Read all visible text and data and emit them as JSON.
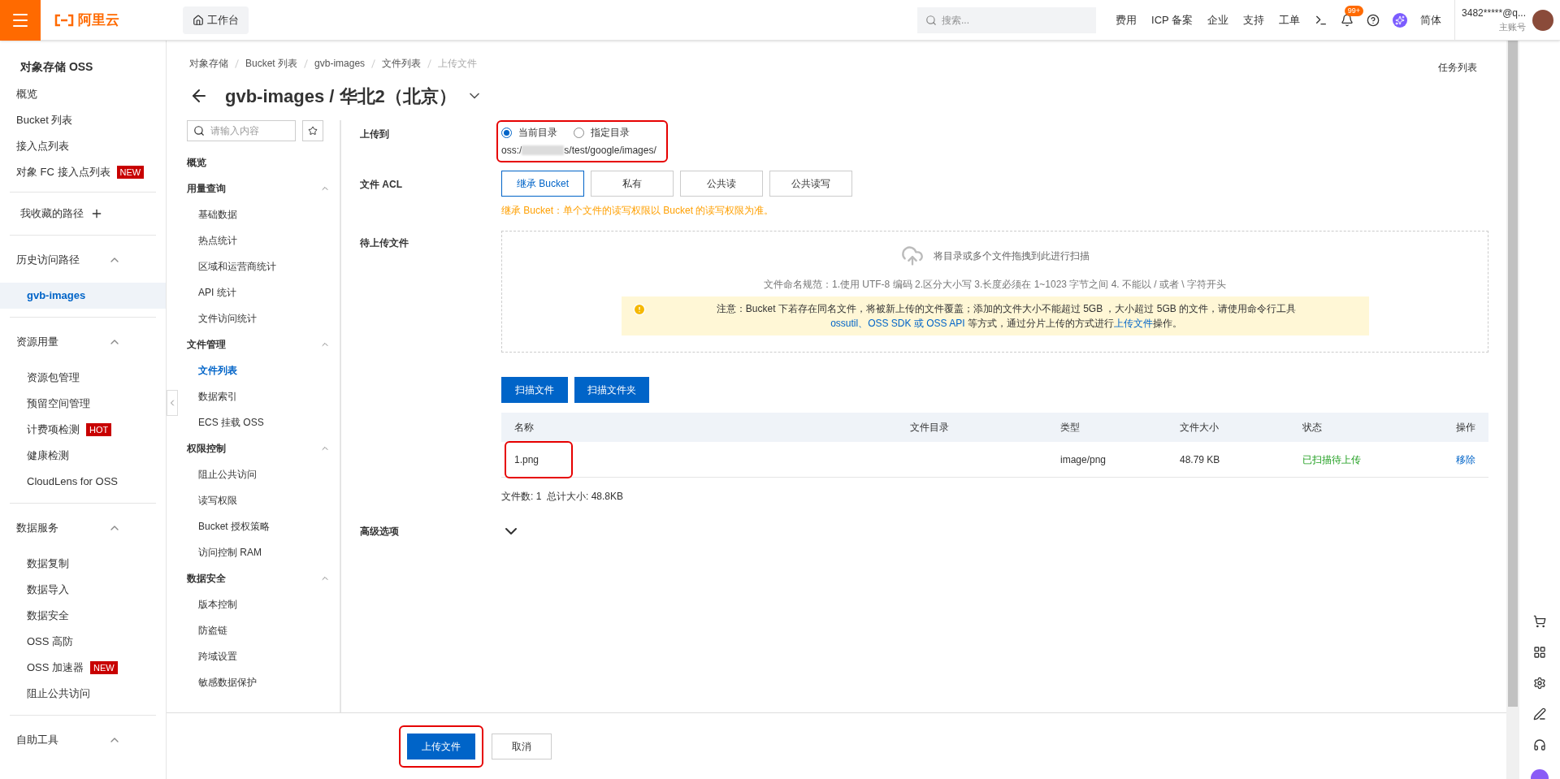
{
  "topbar": {
    "logo": "阿里云",
    "workbench": "工作台",
    "search": {
      "placeholder": "搜索..."
    },
    "links": [
      "费用",
      "ICP 备案",
      "企业",
      "支持",
      "工单"
    ],
    "notifications": "99+",
    "language": "简体",
    "account": "3482*****@q...",
    "account_type": "主账号"
  },
  "sidebar": {
    "title": "对象存储 OSS",
    "items": [
      {
        "label": "概览"
      },
      {
        "label": "Bucket 列表"
      },
      {
        "label": "接入点列表"
      },
      {
        "label": "对象 FC 接入点列表",
        "badge": "NEW"
      }
    ],
    "favorites": "我收藏的路径",
    "groups": [
      {
        "label": "历史访问路径",
        "expanded": true,
        "items": [
          {
            "label": "gvb-images",
            "selected": true
          }
        ]
      },
      {
        "label": "资源用量",
        "expanded": true,
        "items": [
          {
            "label": "资源包管理",
            "selected": false
          },
          {
            "label": "预留空间管理",
            "selected": false
          },
          {
            "label": "计费项检测",
            "badge": "HOT",
            "selected": false
          },
          {
            "label": "健康检测",
            "selected": false
          },
          {
            "label": "CloudLens for OSS",
            "selected": false
          }
        ]
      },
      {
        "label": "数据服务",
        "expanded": true,
        "items": [
          {
            "label": "数据复制",
            "selected": false
          },
          {
            "label": "数据导入",
            "selected": false
          },
          {
            "label": "数据安全",
            "selected": false
          },
          {
            "label": "OSS 高防",
            "selected": false
          },
          {
            "label": "OSS 加速器",
            "badge": "NEW",
            "selected": false
          },
          {
            "label": "阻止公共访问",
            "selected": false
          }
        ]
      },
      {
        "label": "自助工具",
        "expanded": true
      }
    ]
  },
  "breadcrumb": [
    "对象存储",
    "Bucket 列表",
    "gvb-images",
    "文件列表",
    "上传文件"
  ],
  "title": "gvb-images / 华北2（北京）",
  "task_list": "任务列表",
  "bucket_nav": {
    "search": {
      "placeholder": "请输入内容"
    },
    "top": "概览",
    "groups": [
      {
        "label": "用量查询",
        "expanded": true,
        "items": [
          {
            "label": "基础数据",
            "selected": false
          },
          {
            "label": "热点统计",
            "selected": false
          },
          {
            "label": "区域和运营商统计",
            "selected": false
          },
          {
            "label": "API 统计",
            "selected": false
          },
          {
            "label": "文件访问统计",
            "selected": false
          }
        ]
      },
      {
        "label": "文件管理",
        "expanded": true,
        "items": [
          {
            "label": "文件列表",
            "selected": true
          },
          {
            "label": "数据索引",
            "selected": false
          },
          {
            "label": "ECS 挂载 OSS",
            "selected": false
          }
        ]
      },
      {
        "label": "权限控制",
        "expanded": true,
        "items": [
          {
            "label": "阻止公共访问",
            "selected": false
          },
          {
            "label": "读写权限",
            "selected": false
          },
          {
            "label": "Bucket 授权策略",
            "selected": false
          },
          {
            "label": "访问控制 RAM",
            "selected": false
          }
        ]
      },
      {
        "label": "数据安全",
        "expanded": true,
        "items": [
          {
            "label": "版本控制",
            "selected": false
          },
          {
            "label": "防盗链",
            "selected": false
          },
          {
            "label": "跨域设置",
            "selected": false
          },
          {
            "label": "敏感数据保护",
            "selected": false
          }
        ]
      }
    ]
  },
  "form": {
    "upload_to": {
      "label": "上传到",
      "options": [
        {
          "label": "当前目录",
          "selected": true
        },
        {
          "label": "指定目录",
          "selected": false
        }
      ],
      "path_start": "oss:/",
      "path_end": "s/test/google/images/"
    },
    "acl": {
      "label": "文件 ACL",
      "options": [
        {
          "label": "继承 Bucket",
          "selected": true
        },
        {
          "label": "私有",
          "selected": false
        },
        {
          "label": "公共读",
          "selected": false
        },
        {
          "label": "公共读写",
          "selected": false
        }
      ],
      "hint": "继承 Bucket：单个文件的读写权限以 Bucket 的读写权限为准。"
    },
    "files": {
      "label": "待上传文件",
      "drop_text": "将目录或多个文件拖拽到此进行扫描",
      "naming_rules": "文件命名规范：1.使用 UTF-8 编码 2.区分大小写 3.长度必须在 1~1023 字节之间 4. 不能以 / 或者 \\ 字符开头",
      "notice": {
        "before": "注意：Bucket 下若存在同名文件，将被新上传的文件覆盖；添加的文件大小不能超过 5GB ，大小超过 5GB 的文件，请使用命令行工具 ",
        "link1": "ossutil、OSS SDK 或 OSS API",
        "middle": " 等方式，通过分片上传的方式进行",
        "link2": "上传文件",
        "after": "操作。"
      },
      "buttons": [
        "扫描文件",
        "扫描文件夹"
      ],
      "table": {
        "columns": [
          "名称",
          "文件目录",
          "类型",
          "文件大小",
          "状态",
          "操作"
        ],
        "rows": [
          {
            "name": "1.png",
            "type": "image/png",
            "size": "48.79 KB",
            "status": "已扫描待上传",
            "action": "移除"
          }
        ]
      },
      "summary": "文件数: 1  总计大小: 48.8KB"
    },
    "advanced": {
      "label": "高级选项",
      "expanded": false
    }
  },
  "footer": {
    "buttons": [
      {
        "label": "上传文件",
        "kind": "primary"
      },
      {
        "label": "取消",
        "kind": "default"
      }
    ]
  }
}
